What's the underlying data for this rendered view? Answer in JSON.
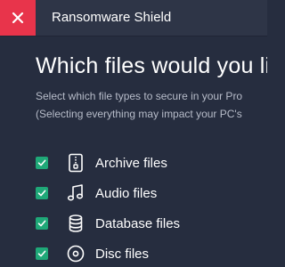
{
  "window": {
    "title": "Ransomware Shield",
    "close_icon": "close-icon"
  },
  "main": {
    "heading": "Which files would you like",
    "description_line1": "Select which file types to secure in your Pro",
    "description_line2": "(Selecting everything may impact your PC's",
    "file_types": [
      {
        "label": "Archive files",
        "checked": true,
        "icon": "archive-file-icon"
      },
      {
        "label": "Audio files",
        "checked": true,
        "icon": "music-note-icon"
      },
      {
        "label": "Database files",
        "checked": true,
        "icon": "database-icon"
      },
      {
        "label": "Disc files",
        "checked": true,
        "icon": "disc-icon"
      }
    ]
  },
  "colors": {
    "background": "#262d3f",
    "titlebar": "#2e3547",
    "close_button": "#e8344b",
    "checkbox": "#1fa878",
    "secondary_text": "#b7bcc9"
  }
}
